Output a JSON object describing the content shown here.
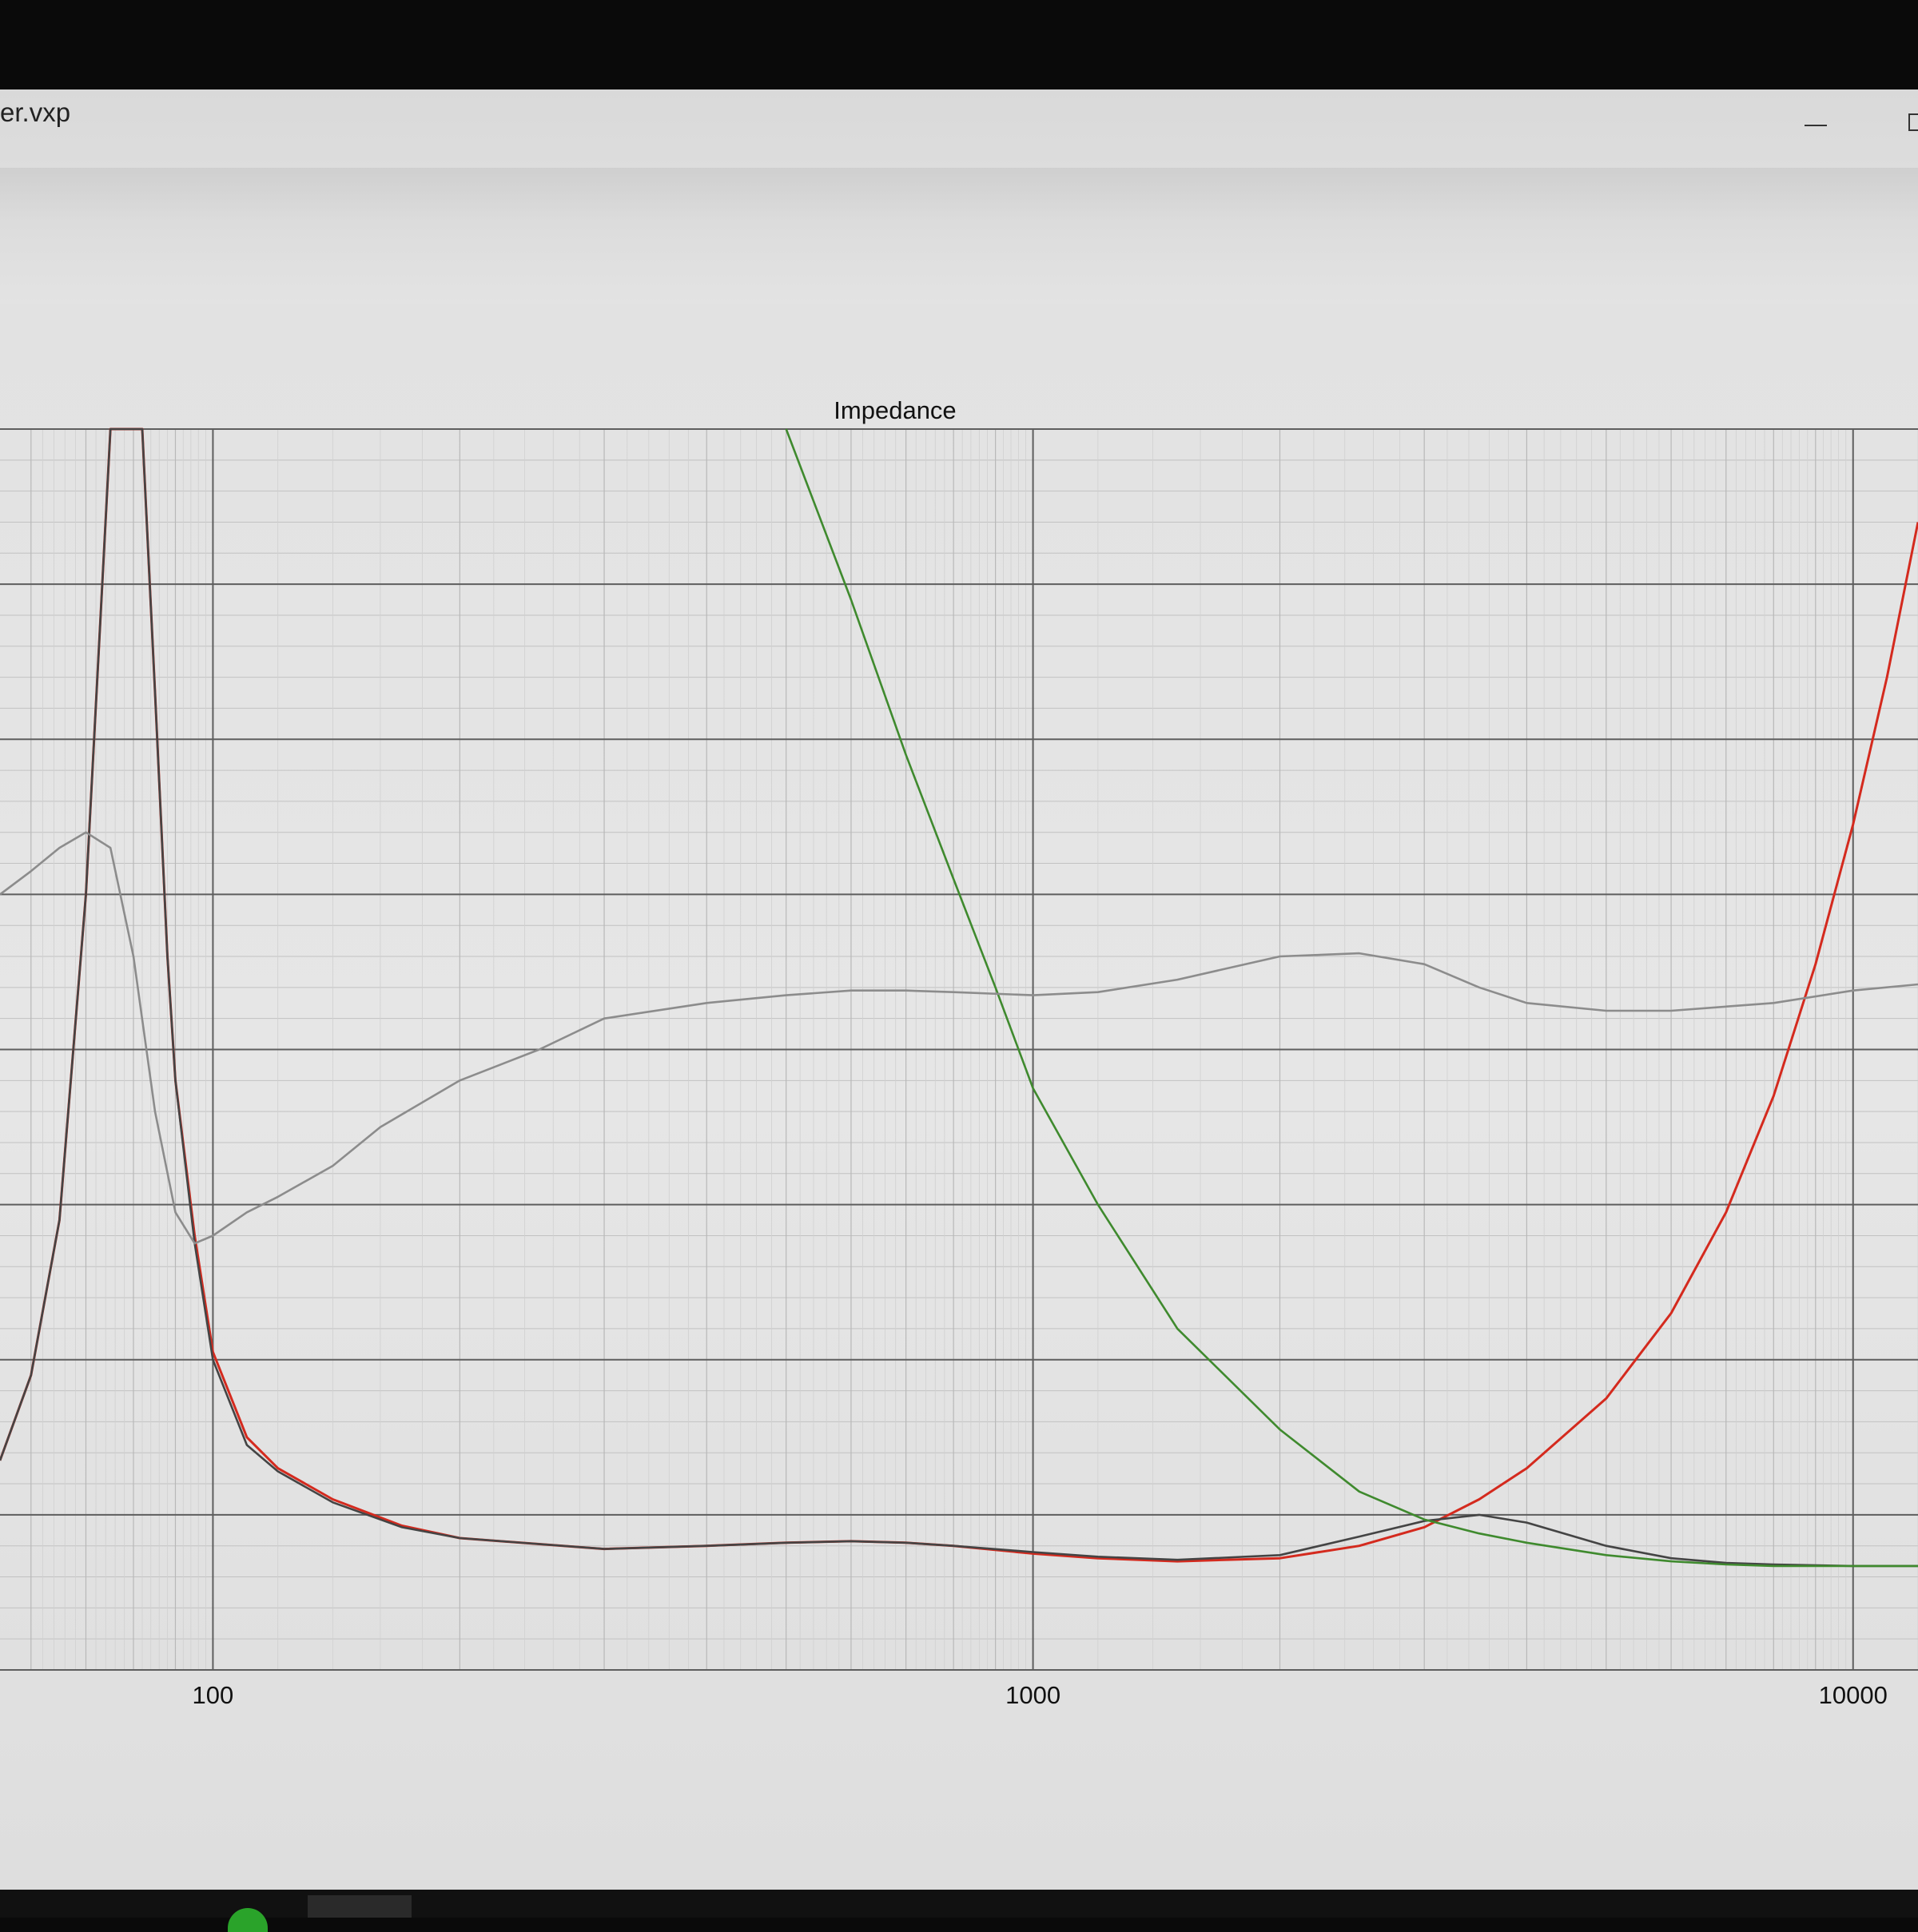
{
  "window": {
    "title": "er.vxp"
  },
  "chart_data": {
    "type": "line",
    "title": "Impedance",
    "xscale": "log",
    "xlim": [
      55,
      12000
    ],
    "ylim": [
      0,
      8
    ],
    "xticks": [
      100,
      1000,
      10000
    ],
    "xtick_labels": [
      "100",
      "1000",
      "10000"
    ],
    "grid": true,
    "series": [
      {
        "color": "#d42a1e",
        "x": [
          55,
          60,
          65,
          70,
          75,
          80,
          82,
          85,
          88,
          90,
          95,
          100,
          110,
          120,
          140,
          170,
          200,
          300,
          400,
          500,
          600,
          700,
          800,
          1000,
          1200,
          1500,
          2000,
          2500,
          3000,
          3500,
          4000,
          5000,
          6000,
          7000,
          8000,
          9000,
          10000,
          11000,
          12000
        ],
        "y": [
          1.35,
          1.9,
          2.9,
          5.0,
          8.0,
          8.0,
          8.0,
          6.3,
          4.6,
          3.8,
          2.8,
          2.05,
          1.5,
          1.3,
          1.1,
          0.93,
          0.85,
          0.78,
          0.8,
          0.82,
          0.83,
          0.82,
          0.8,
          0.75,
          0.72,
          0.7,
          0.72,
          0.8,
          0.92,
          1.1,
          1.3,
          1.75,
          2.3,
          2.95,
          3.7,
          4.55,
          5.45,
          6.4,
          7.4
        ]
      },
      {
        "color": "#444444",
        "x": [
          55,
          60,
          65,
          70,
          75,
          80,
          82,
          85,
          88,
          90,
          95,
          100,
          110,
          120,
          140,
          170,
          200,
          300,
          400,
          500,
          600,
          700,
          800,
          1000,
          1200,
          1500,
          2000,
          2500,
          3000,
          3500,
          4000,
          5000,
          6000,
          7000,
          8000,
          10000,
          12000
        ],
        "y": [
          1.35,
          1.9,
          2.9,
          5.0,
          8.0,
          8.0,
          8.0,
          6.3,
          4.6,
          3.8,
          2.75,
          2.0,
          1.45,
          1.28,
          1.08,
          0.92,
          0.85,
          0.78,
          0.8,
          0.82,
          0.83,
          0.82,
          0.8,
          0.76,
          0.73,
          0.71,
          0.74,
          0.86,
          0.96,
          1.0,
          0.95,
          0.8,
          0.72,
          0.69,
          0.68,
          0.67,
          0.67
        ]
      },
      {
        "color": "#3f8a2e",
        "x": [
          500,
          600,
          700,
          800,
          900,
          1000,
          1200,
          1500,
          2000,
          2500,
          3000,
          3500,
          4000,
          5000,
          6000,
          7000,
          8000,
          9000,
          10000,
          12000
        ],
        "y": [
          8.0,
          6.9,
          5.9,
          5.1,
          4.4,
          3.75,
          3.0,
          2.2,
          1.55,
          1.15,
          0.97,
          0.88,
          0.82,
          0.74,
          0.7,
          0.68,
          0.67,
          0.67,
          0.67,
          0.67
        ]
      },
      {
        "color": "#8c8c8c",
        "x": [
          55,
          60,
          65,
          70,
          75,
          80,
          85,
          90,
          95,
          100,
          110,
          120,
          140,
          160,
          200,
          250,
          300,
          400,
          500,
          600,
          700,
          800,
          1000,
          1200,
          1500,
          2000,
          2500,
          3000,
          3500,
          4000,
          5000,
          6000,
          8000,
          10000,
          12000
        ],
        "y": [
          5.0,
          5.15,
          5.3,
          5.4,
          5.3,
          4.6,
          3.6,
          2.95,
          2.75,
          2.8,
          2.95,
          3.05,
          3.25,
          3.5,
          3.8,
          4.0,
          4.2,
          4.3,
          4.35,
          4.38,
          4.38,
          4.37,
          4.35,
          4.37,
          4.45,
          4.6,
          4.62,
          4.55,
          4.4,
          4.3,
          4.25,
          4.25,
          4.3,
          4.38,
          4.42
        ]
      }
    ]
  }
}
